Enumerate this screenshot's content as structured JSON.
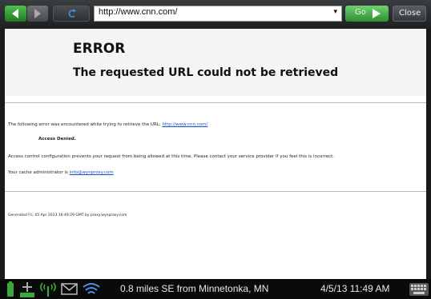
{
  "browser": {
    "url": "http://www.cnn.com/",
    "go_label": "Go",
    "close_label": "Close"
  },
  "page": {
    "title": "ERROR",
    "subtitle": "The requested URL could not be retrieved",
    "line1_text": "The following error was encountered while trying to retrieve the URL: ",
    "line1_link": "http://www.cnn.com/",
    "access_denied": "Access Denied.",
    "line2_text": "Access control configuration prevents your request from being allowed at this time. Please contact your service provider if you feel this is incorrect.",
    "line3_text": "Your cache administrator is ",
    "line3_link": "info@wynproxy.com",
    "footer": "Generated Fri, 05 Apr 2013 16:49:29 GMT by proxy.wynproxy.com"
  },
  "statusbar": {
    "location": "0.8 miles SE from Minnetonka, MN",
    "datetime": "4/5/13 11:49 AM",
    "icons": [
      "battery-icon",
      "gps-icon",
      "signal-icon",
      "mail-icon",
      "wifi-icon",
      "keyboard-icon"
    ]
  },
  "colors": {
    "accent_green": "#3aa83a",
    "link_blue": "#1a4fd0"
  }
}
